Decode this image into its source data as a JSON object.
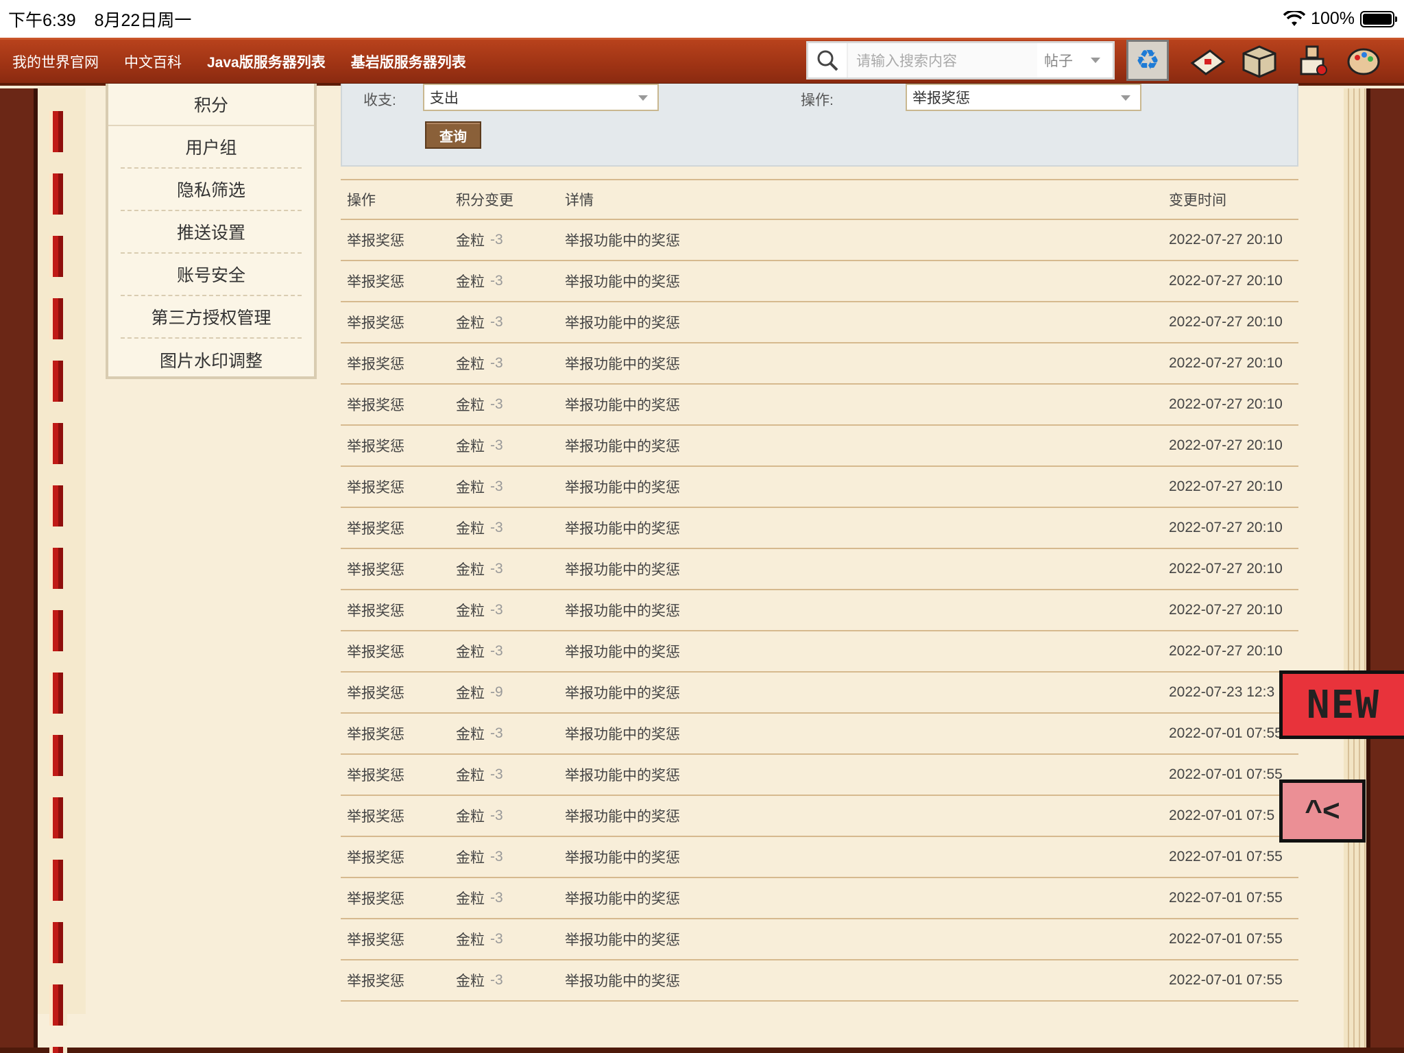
{
  "status_bar": {
    "time": "下午6:39",
    "date": "8月22日周一",
    "battery": "100%"
  },
  "top_nav": {
    "links": [
      "我的世界官网",
      "中文百科",
      "Java版服务器列表",
      "基岩版服务器列表"
    ],
    "search_placeholder": "请输入搜索内容",
    "search_scope": "帖子"
  },
  "sidebar": {
    "items": [
      "积分",
      "用户组",
      "隐私筛选",
      "推送设置",
      "账号安全",
      "第三方授权管理",
      "图片水印调整"
    ]
  },
  "filter": {
    "income_label": "收支:",
    "income_value": "支出",
    "action_label": "操作:",
    "action_value": "举报奖惩",
    "query_button": "查询"
  },
  "table": {
    "headers": [
      "操作",
      "积分变更",
      "详情",
      "变更时间"
    ],
    "rows": [
      {
        "action": "举报奖惩",
        "currency": "金粒",
        "amount": "-3",
        "detail": "举报功能中的奖惩",
        "time": "2022-07-27 20:10"
      },
      {
        "action": "举报奖惩",
        "currency": "金粒",
        "amount": "-3",
        "detail": "举报功能中的奖惩",
        "time": "2022-07-27 20:10"
      },
      {
        "action": "举报奖惩",
        "currency": "金粒",
        "amount": "-3",
        "detail": "举报功能中的奖惩",
        "time": "2022-07-27 20:10"
      },
      {
        "action": "举报奖惩",
        "currency": "金粒",
        "amount": "-3",
        "detail": "举报功能中的奖惩",
        "time": "2022-07-27 20:10"
      },
      {
        "action": "举报奖惩",
        "currency": "金粒",
        "amount": "-3",
        "detail": "举报功能中的奖惩",
        "time": "2022-07-27 20:10"
      },
      {
        "action": "举报奖惩",
        "currency": "金粒",
        "amount": "-3",
        "detail": "举报功能中的奖惩",
        "time": "2022-07-27 20:10"
      },
      {
        "action": "举报奖惩",
        "currency": "金粒",
        "amount": "-3",
        "detail": "举报功能中的奖惩",
        "time": "2022-07-27 20:10"
      },
      {
        "action": "举报奖惩",
        "currency": "金粒",
        "amount": "-3",
        "detail": "举报功能中的奖惩",
        "time": "2022-07-27 20:10"
      },
      {
        "action": "举报奖惩",
        "currency": "金粒",
        "amount": "-3",
        "detail": "举报功能中的奖惩",
        "time": "2022-07-27 20:10"
      },
      {
        "action": "举报奖惩",
        "currency": "金粒",
        "amount": "-3",
        "detail": "举报功能中的奖惩",
        "time": "2022-07-27 20:10"
      },
      {
        "action": "举报奖惩",
        "currency": "金粒",
        "amount": "-3",
        "detail": "举报功能中的奖惩",
        "time": "2022-07-27 20:10"
      },
      {
        "action": "举报奖惩",
        "currency": "金粒",
        "amount": "-9",
        "detail": "举报功能中的奖惩",
        "time": "2022-07-23 12:3"
      },
      {
        "action": "举报奖惩",
        "currency": "金粒",
        "amount": "-3",
        "detail": "举报功能中的奖惩",
        "time": "2022-07-01 07:55"
      },
      {
        "action": "举报奖惩",
        "currency": "金粒",
        "amount": "-3",
        "detail": "举报功能中的奖惩",
        "time": "2022-07-01 07:55"
      },
      {
        "action": "举报奖惩",
        "currency": "金粒",
        "amount": "-3",
        "detail": "举报功能中的奖惩",
        "time": "2022-07-01 07:5"
      },
      {
        "action": "举报奖惩",
        "currency": "金粒",
        "amount": "-3",
        "detail": "举报功能中的奖惩",
        "time": "2022-07-01 07:55"
      },
      {
        "action": "举报奖惩",
        "currency": "金粒",
        "amount": "-3",
        "detail": "举报功能中的奖惩",
        "time": "2022-07-01 07:55"
      },
      {
        "action": "举报奖惩",
        "currency": "金粒",
        "amount": "-3",
        "detail": "举报功能中的奖惩",
        "time": "2022-07-01 07:55"
      },
      {
        "action": "举报奖惩",
        "currency": "金粒",
        "amount": "-3",
        "detail": "举报功能中的奖惩",
        "time": "2022-07-01 07:55"
      }
    ]
  },
  "badges": {
    "new_label": "NEW",
    "new_color": "#e8333b",
    "mail_color": "#eb8f95"
  },
  "icons": [
    "search-icon",
    "chevron-down-icon",
    "recycle-icon",
    "envelope-icon",
    "package-icon",
    "user-icon",
    "palette-icon",
    "wifi-icon",
    "battery-icon",
    "mail-icon"
  ]
}
